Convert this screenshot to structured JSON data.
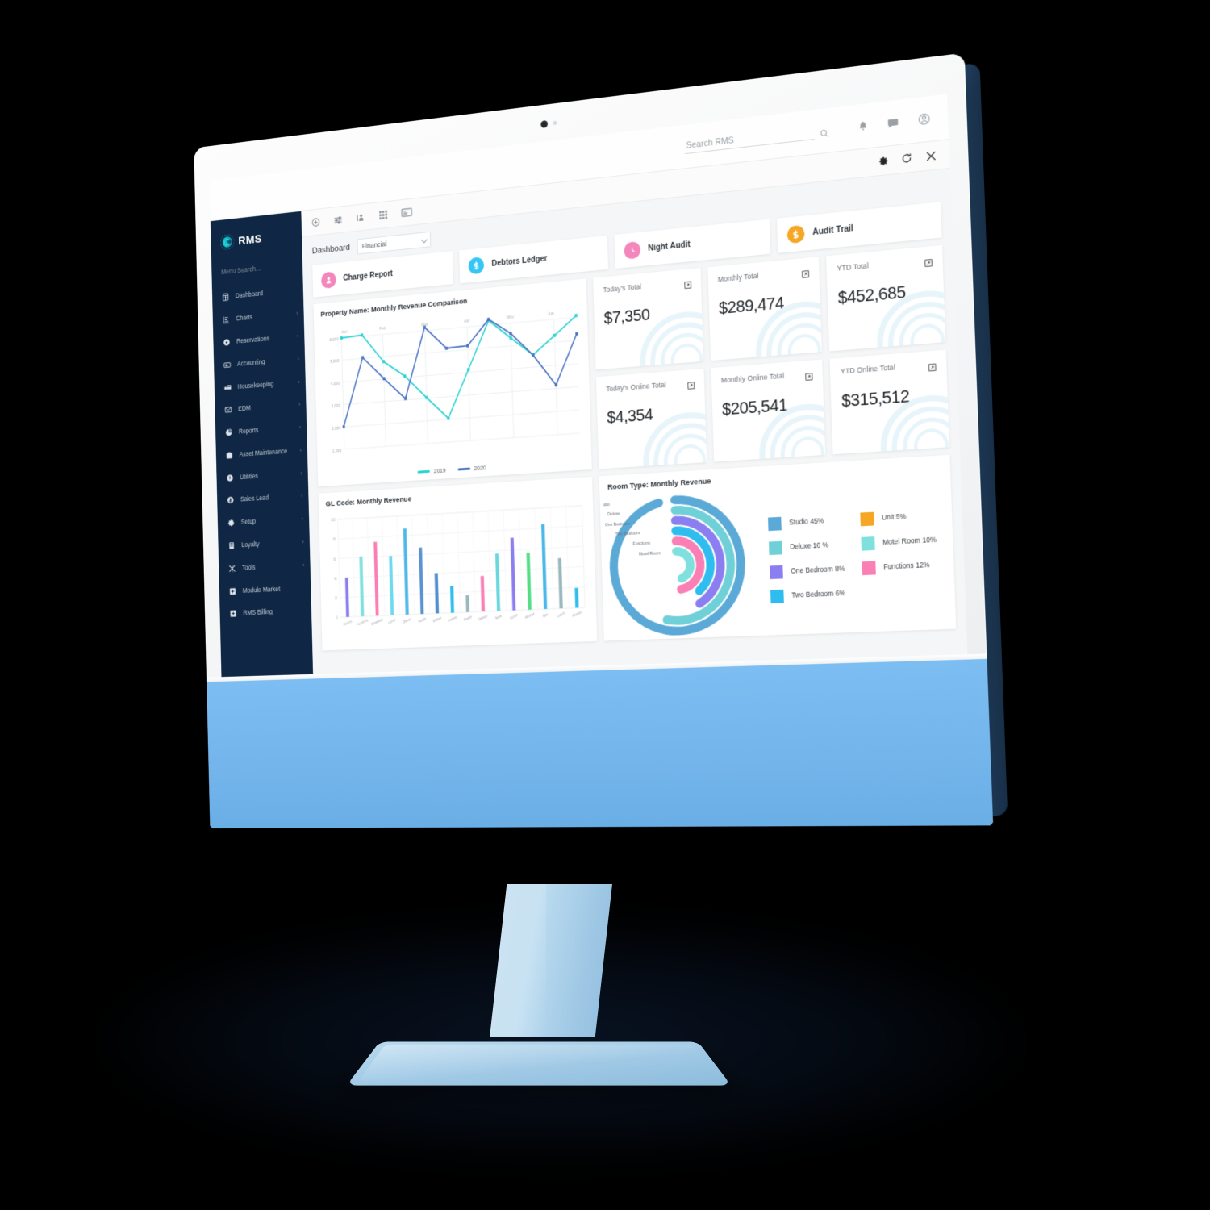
{
  "browser": {
    "search_placeholder": "Search RMS",
    "icons": [
      "search-icon",
      "bell-icon",
      "chat-icon",
      "user-icon"
    ]
  },
  "sidebar": {
    "brand": "RMS",
    "menu_search_placeholder": "Menu Search...",
    "items": [
      {
        "label": "Dashboard",
        "icon": "dashboard-icon",
        "chevron": false
      },
      {
        "label": "Charts",
        "icon": "charts-icon",
        "chevron": true
      },
      {
        "label": "Reservations",
        "icon": "reservations-icon",
        "chevron": true
      },
      {
        "label": "Accounting",
        "icon": "accounting-icon",
        "chevron": true
      },
      {
        "label": "Housekeeping",
        "icon": "housekeeping-icon",
        "chevron": true
      },
      {
        "label": "EDM",
        "icon": "edm-icon",
        "chevron": true
      },
      {
        "label": "Reports",
        "icon": "reports-icon",
        "chevron": true
      },
      {
        "label": "Asset Maintenance",
        "icon": "asset-maintenance-icon",
        "chevron": true
      },
      {
        "label": "Utilities",
        "icon": "utilities-icon",
        "chevron": true
      },
      {
        "label": "Sales Lead",
        "icon": "sales-lead-icon",
        "chevron": true
      },
      {
        "label": "Setup",
        "icon": "setup-gear-icon",
        "chevron": true
      },
      {
        "label": "Loyalty",
        "icon": "loyalty-icon",
        "chevron": true
      },
      {
        "label": "Tools",
        "icon": "tools-icon",
        "chevron": true
      },
      {
        "label": "Module Market",
        "icon": "module-market-icon",
        "chevron": false
      },
      {
        "label": "RMS Billing",
        "icon": "rms-billing-icon",
        "chevron": false
      }
    ]
  },
  "toolbar": {
    "icons": [
      "plus-circle-icon",
      "sliders-icon",
      "guest-location-icon",
      "grid-apps-icon",
      "cash-register-icon"
    ],
    "window_controls": [
      "gear-icon",
      "refresh-icon",
      "close-icon"
    ]
  },
  "dashboard": {
    "label": "Dashboard",
    "selected_view": "Financial",
    "view_options": [
      "Financial"
    ]
  },
  "quick_cards": [
    {
      "label": "Charge Report",
      "icon": "person-circle-icon",
      "color": "#f386bb"
    },
    {
      "label": "Debtors Ledger",
      "icon": "dollar-circle-icon",
      "color": "#34c6f4"
    },
    {
      "label": "Night Audit",
      "icon": "clock-circle-icon",
      "color": "#f386bb"
    },
    {
      "label": "Audit Trail",
      "icon": "dollar-circle-icon",
      "color": "#f5a623"
    }
  ],
  "stats": [
    {
      "label": "Today's Total",
      "value": "$7,350"
    },
    {
      "label": "Monthly Total",
      "value": "$289,474"
    },
    {
      "label": "YTD Total",
      "value": "$452,685"
    },
    {
      "label": "Today's Online Total",
      "value": "$4,354"
    },
    {
      "label": "Monthly Online Total",
      "value": "$205,541"
    },
    {
      "label": "YTD Online Total",
      "value": "$315,512"
    }
  ],
  "panels": {
    "line_title": "Property Name: Monthly Revenue Comparison",
    "bar_title": "GL Code: Monthly Revenue",
    "donut_title": "Room Type: Monthly Revenue"
  },
  "chart_data": [
    {
      "type": "line",
      "title": "Property Name: Monthly Revenue Comparison",
      "xlabel": "",
      "ylabel": "",
      "categories": [
        "Jan",
        "Feb",
        "Mar",
        "Apr",
        "May",
        "Jun"
      ],
      "x": [
        1,
        2,
        3,
        4,
        5,
        6,
        7,
        8,
        9,
        10,
        11,
        12
      ],
      "ylim": [
        1000,
        6000
      ],
      "yticks": [
        1000,
        2000,
        3000,
        4000,
        5000,
        6000
      ],
      "grid": true,
      "legend_position": "bottom",
      "series": [
        {
          "name": "2019",
          "color": "#2ad2d2",
          "values": [
            6000,
            6050,
            4780,
            4060,
            3030,
            2050,
            4120,
            6200,
            5350,
            4530,
            5300,
            6080
          ]
        },
        {
          "name": "2020",
          "color": "#4a72c4",
          "values": [
            2010,
            5040,
            4020,
            3060,
            6150,
            5140,
            5170,
            6250,
            5550,
            4520,
            3150,
            5290
          ]
        }
      ]
    },
    {
      "type": "bar",
      "title": "GL Code: Monthly Revenue",
      "xlabel": "",
      "ylabel": "",
      "ylim": [
        0,
        100
      ],
      "yticks": [
        0,
        20,
        40,
        60,
        80,
        100
      ],
      "grid": true,
      "categories": [
        "Rooms",
        "Functions",
        "Breakfast",
        "Lunch",
        "Dinner",
        "Studio",
        "Deluxe",
        "Rooms",
        "Studio",
        "Deluxe",
        "Suite",
        "Lunch",
        "Alcohol",
        "Spa",
        "Lunch",
        "Rooms"
      ],
      "values": [
        40,
        61,
        75,
        60,
        87,
        67,
        40.5,
        27,
        17,
        35.5,
        57,
        72,
        56.5,
        84,
        49.5,
        19.5
      ],
      "colors": [
        "#8b7ef0",
        "#7fe0de",
        "#f97fb4",
        "#6fd9f0",
        "#4db8e8",
        "#5b92d1",
        "#4f8fd0",
        "#2fbdf0",
        "#9ab8bc",
        "#f97fb4",
        "#6ad7dd",
        "#8b7ef0",
        "#52dd85",
        "#4db8e8",
        "#9ab8bc",
        "#2fbdf0"
      ]
    },
    {
      "type": "pie",
      "title": "Room Type: Monthly Revenue",
      "chart_style": "radial-bar",
      "axis_labels": [
        "Studio",
        "Deluxe",
        "One Bedroom",
        "Two Bedroom",
        "Functions",
        "Motel Room"
      ],
      "legend_position": "right",
      "slices": [
        {
          "label": "Studio",
          "value": 45,
          "display": "Studio 45%",
          "color": "#5aa9d6"
        },
        {
          "label": "Deluxe",
          "value": 16,
          "display": "Deluxe 16 %",
          "color": "#6fd0d8"
        },
        {
          "label": "One Bedroom",
          "value": 8,
          "display": "One Bedroom 8%",
          "color": "#8b7ef0"
        },
        {
          "label": "Two Bedroom",
          "value": 6,
          "display": "Two Bedroom 6%",
          "color": "#2fbdf0"
        },
        {
          "label": "Unit",
          "value": 5,
          "display": "Unit 5%",
          "color": "#f5a623"
        },
        {
          "label": "Motel Room",
          "value": 10,
          "display": "Motel Room 10%",
          "color": "#7fe0de"
        },
        {
          "label": "Functions",
          "value": 12,
          "display": "Functions 12%",
          "color": "#f97fb4"
        }
      ]
    }
  ]
}
